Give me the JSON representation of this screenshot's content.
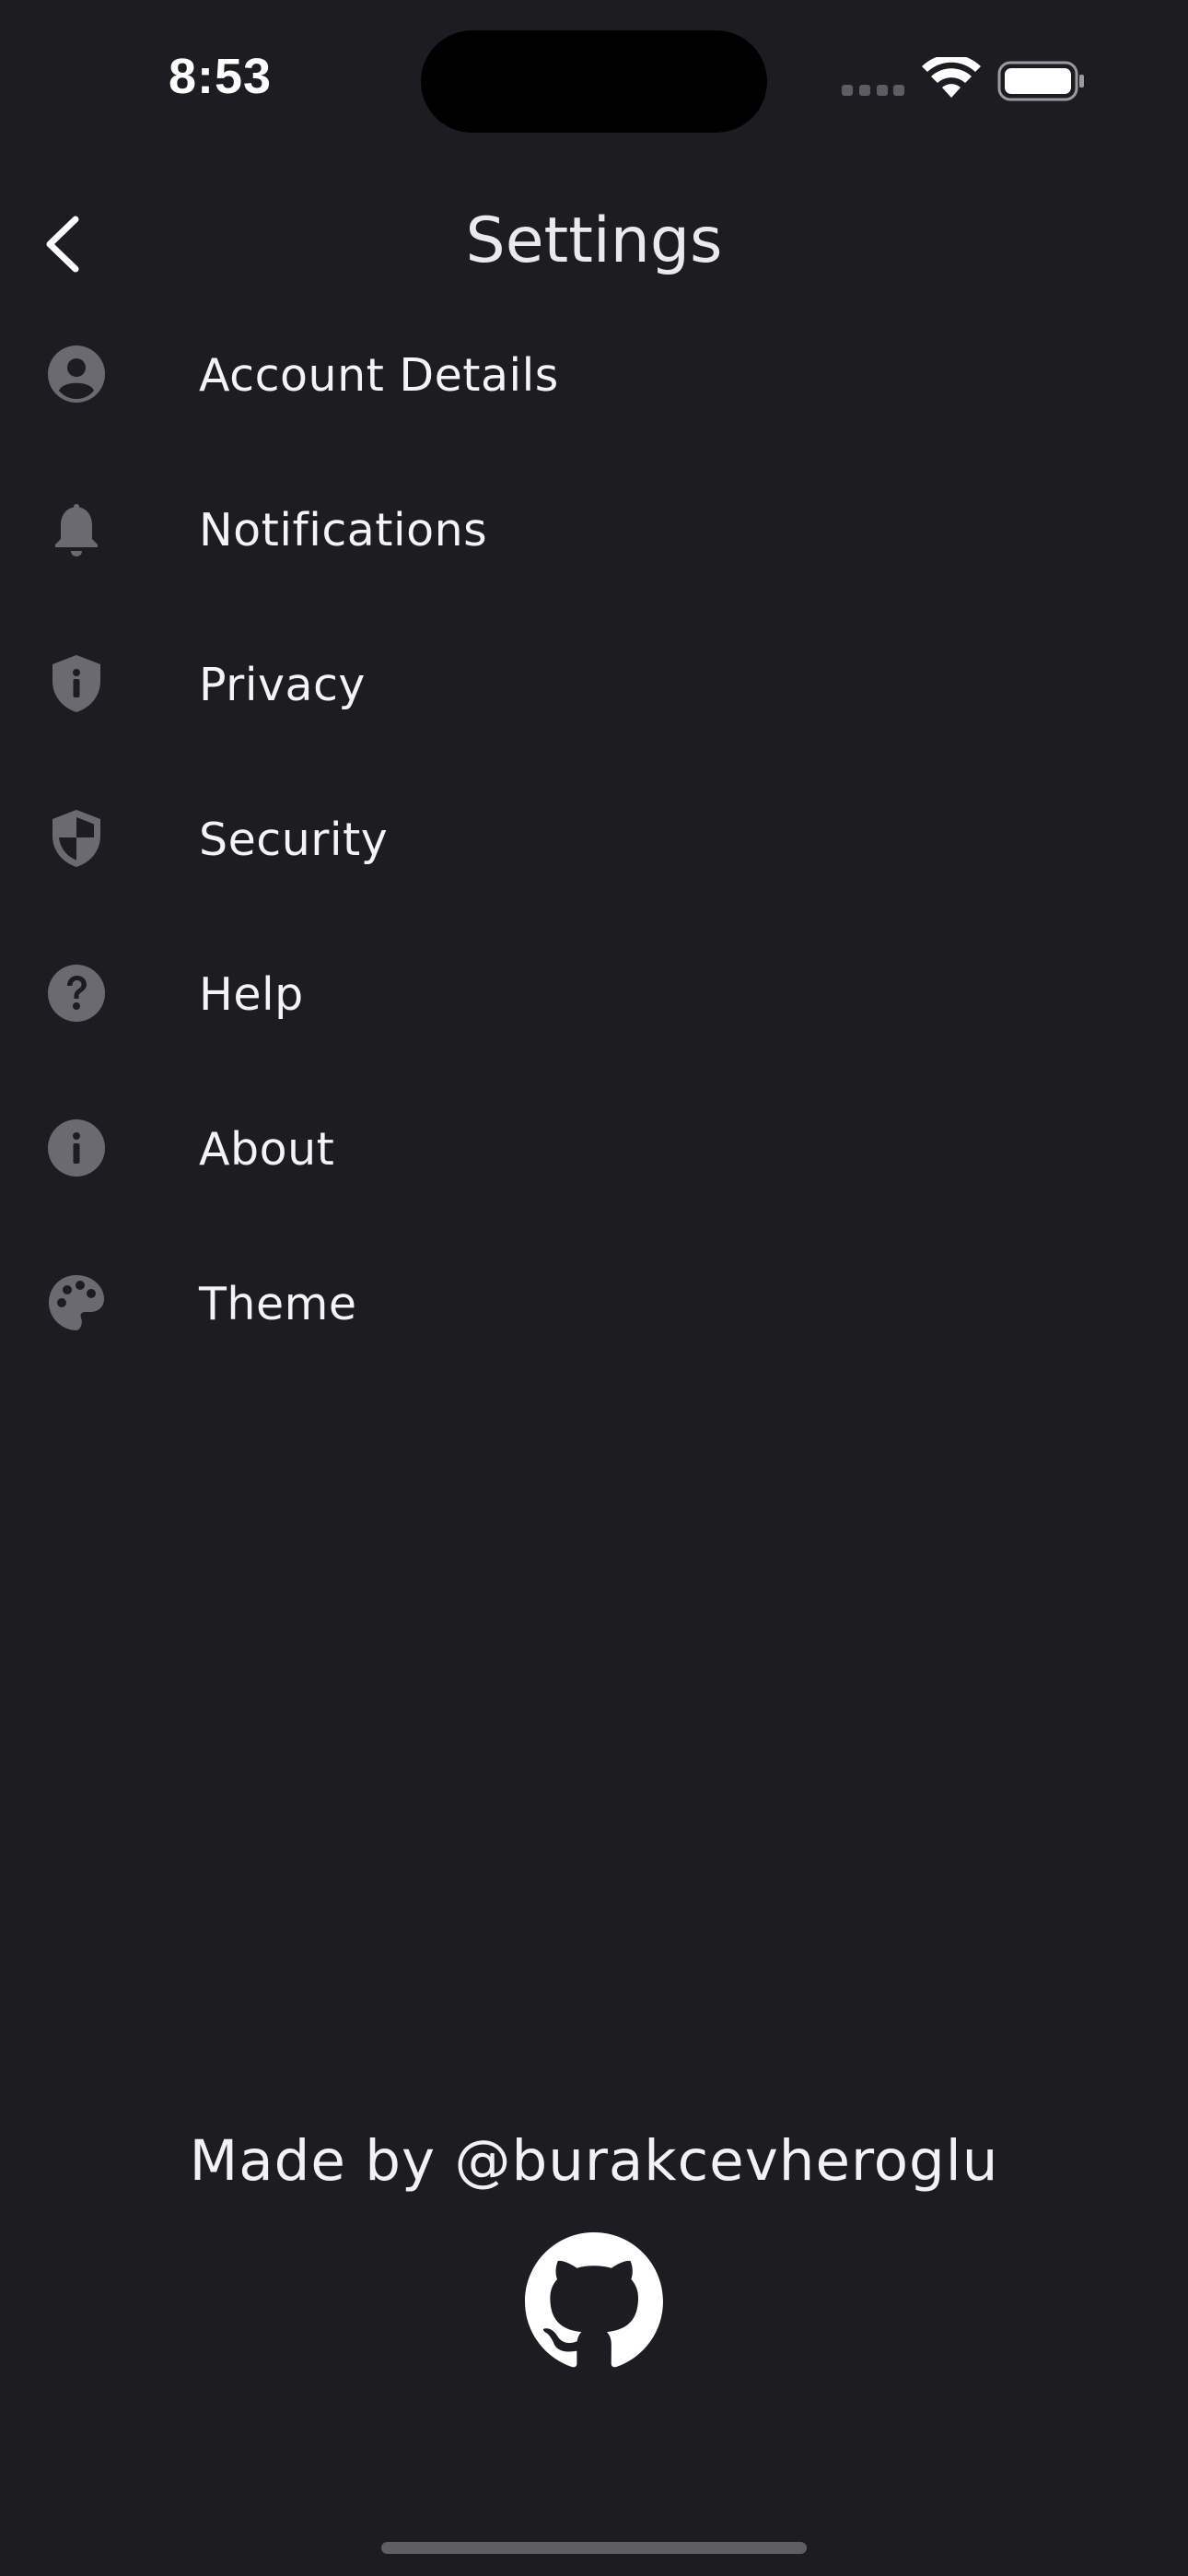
{
  "status_bar": {
    "time": "8:53",
    "icons": [
      "signal-dots-icon",
      "wifi-icon",
      "battery-icon"
    ]
  },
  "header": {
    "title": "Settings",
    "back_icon": "chevron-left-icon"
  },
  "menu": {
    "items": [
      {
        "label": "Account Details",
        "icon": "account-circle-icon"
      },
      {
        "label": "Notifications",
        "icon": "bell-icon"
      },
      {
        "label": "Privacy",
        "icon": "shield-info-icon"
      },
      {
        "label": "Security",
        "icon": "shield-half-icon"
      },
      {
        "label": "Help",
        "icon": "help-circle-icon"
      },
      {
        "label": "About",
        "icon": "info-circle-icon"
      },
      {
        "label": "Theme",
        "icon": "palette-icon"
      }
    ]
  },
  "footer": {
    "credit": "Made by @burakcevheroglu",
    "link_icon": "github-icon"
  },
  "colors": {
    "background": "#1d1c21",
    "icon": "#6b6a70",
    "text": "#ffffff"
  }
}
